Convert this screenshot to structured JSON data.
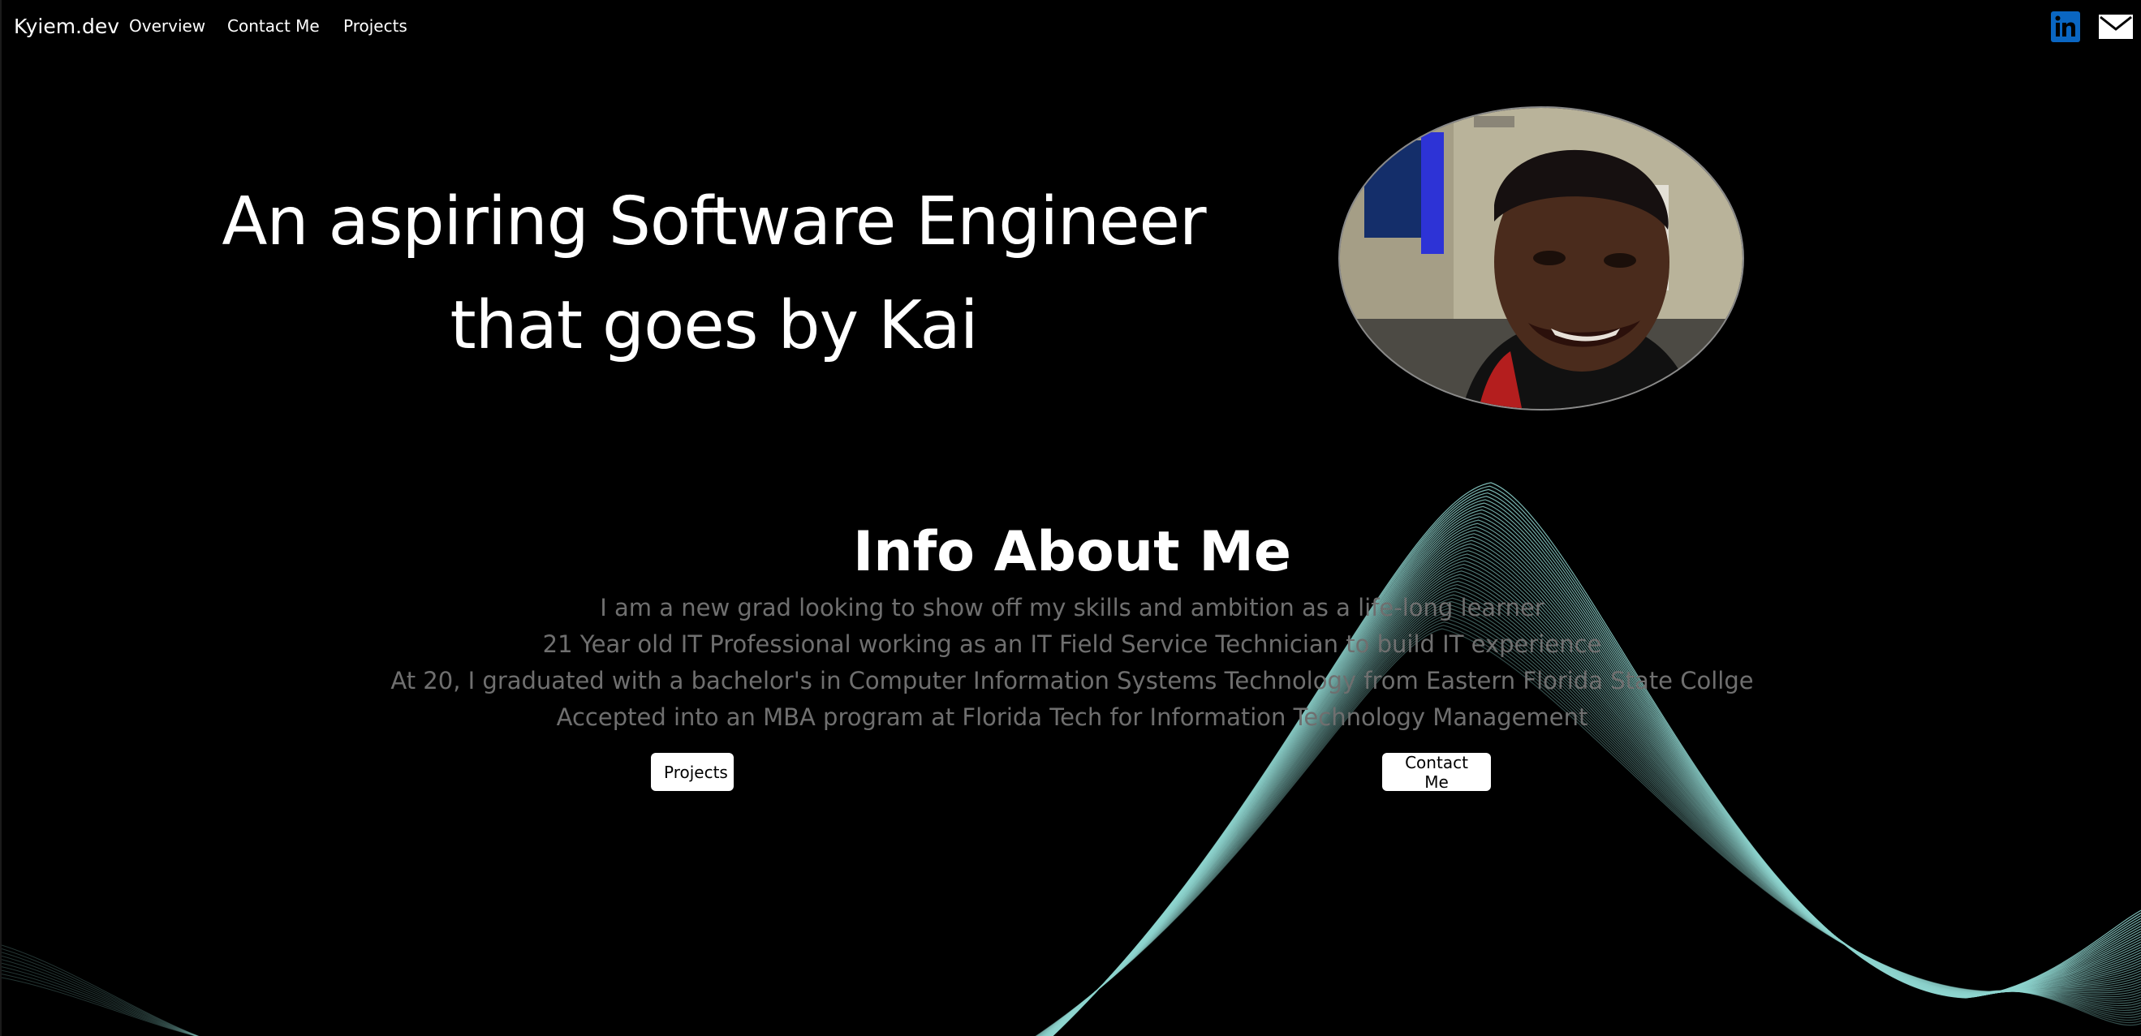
{
  "navbar": {
    "brand": "Kyiem.dev",
    "links": [
      "Overview",
      "Contact Me",
      "Projects"
    ],
    "social": [
      "linkedin-icon",
      "mail-icon"
    ]
  },
  "hero": {
    "headline": "An aspiring Software Engineer that goes by Kai"
  },
  "info": {
    "title": "Info About Me",
    "lines": [
      "I am a new grad looking to show off my skills and ambition as a life-long learner",
      "21 Year old IT Professional working as an IT Field Service Technician to build IT experience",
      "At 20, I graduated with a bachelor's in Computer Information Systems Technology from Eastern Florida State Collge",
      "Accepted into an MBA program at Florida Tech for Information Technology Management"
    ]
  },
  "buttons": {
    "projects": "Projects",
    "contact": "Contact Me"
  },
  "colors": {
    "background": "#000000",
    "wave": "#8fd6d0",
    "linkedin": "#0a66c2",
    "muted_text": "#6f6f6f"
  }
}
